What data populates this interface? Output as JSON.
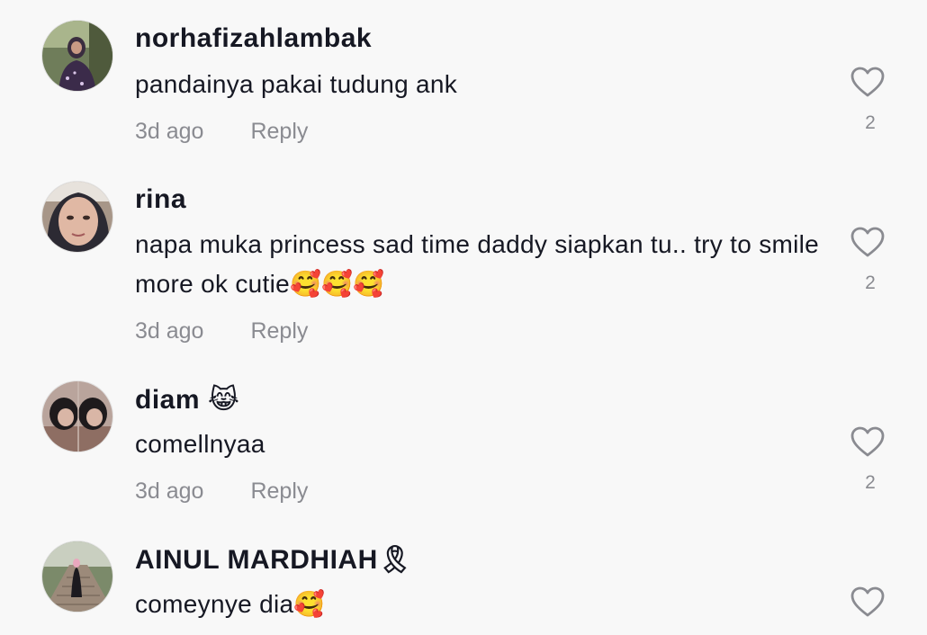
{
  "comments": [
    {
      "username": "norhafizahlambak",
      "text": "pandainya pakai tudung ank",
      "time": "3d ago",
      "reply": "Reply",
      "likes": "2",
      "like_icon": "heart-outline-icon"
    },
    {
      "username": "rina",
      "text": "napa muka princess sad time daddy siapkan tu.. try to smile more ok cutie🥰🥰🥰",
      "time": "3d ago",
      "reply": "Reply",
      "likes": "2",
      "like_icon": "heart-outline-icon"
    },
    {
      "username": "diam 😹",
      "text": "comellnyaa",
      "time": "3d ago",
      "reply": "Reply",
      "likes": "2",
      "like_icon": "heart-outline-icon"
    },
    {
      "username": "AINUL MARDHIAH🎗",
      "text": "comeynye dia🥰",
      "like_icon": "heart-outline-icon"
    }
  ],
  "colors": {
    "background": "#f8f8f8",
    "username": "#161823",
    "meta": "#8a8b91",
    "heart_stroke": "#8a8b91"
  }
}
